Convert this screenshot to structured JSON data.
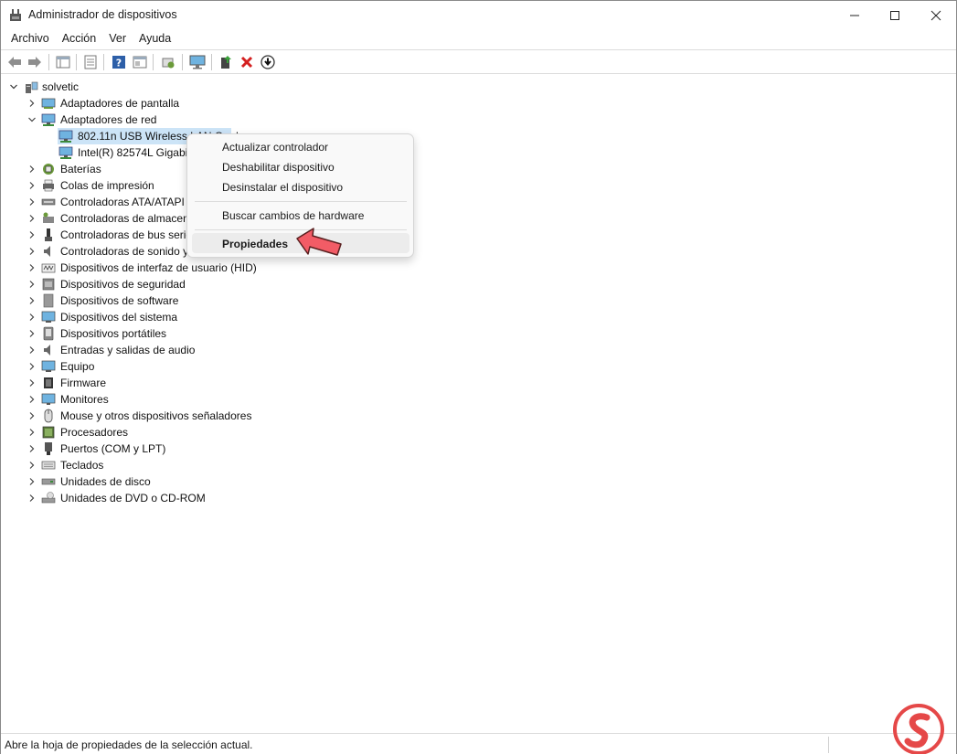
{
  "window": {
    "title": "Administrador de dispositivos"
  },
  "menu": [
    "Archivo",
    "Acción",
    "Ver",
    "Ayuda"
  ],
  "toolbar_icons": [
    "back-arrow-icon",
    "forward-arrow-icon",
    "show-hide-tree-icon",
    "properties-sheet-icon",
    "help-icon",
    "view-pane-icon",
    "scan-hardware-icon",
    "monitor-icon",
    "update-driver-icon",
    "uninstall-x-icon",
    "download-circle-icon"
  ],
  "tree": {
    "root": "solvetic",
    "nodes": [
      {
        "label": "Adaptadores de pantalla",
        "icon": "display-adapter-icon",
        "expanded": false
      },
      {
        "label": "Adaptadores de red",
        "icon": "network-adapter-icon",
        "expanded": true
      },
      {
        "label": "802.11n USB Wireless LAN Card",
        "icon": "network-adapter-icon",
        "child": true,
        "selected": true
      },
      {
        "label": "Intel(R) 82574L Gigabit Network Connection",
        "icon": "network-adapter-icon",
        "child": true
      },
      {
        "label": "Baterías",
        "icon": "battery-icon"
      },
      {
        "label": "Colas de impresión",
        "icon": "printer-icon"
      },
      {
        "label": "Controladoras ATA/ATAPI IDE",
        "icon": "ide-controller-icon"
      },
      {
        "label": "Controladoras de almacenamiento",
        "icon": "storage-controller-icon"
      },
      {
        "label": "Controladoras de bus serie universal",
        "icon": "usb-icon"
      },
      {
        "label": "Controladoras de sonido y vídeo y dispositivos de juego",
        "icon": "speaker-icon"
      },
      {
        "label": "Dispositivos de interfaz de usuario (HID)",
        "icon": "hid-icon"
      },
      {
        "label": "Dispositivos de seguridad",
        "icon": "security-device-icon"
      },
      {
        "label": "Dispositivos de software",
        "icon": "software-device-icon"
      },
      {
        "label": "Dispositivos del sistema",
        "icon": "system-device-icon"
      },
      {
        "label": "Dispositivos portátiles",
        "icon": "portable-device-icon"
      },
      {
        "label": "Entradas y salidas de audio",
        "icon": "audio-io-icon"
      },
      {
        "label": "Equipo",
        "icon": "computer-icon"
      },
      {
        "label": "Firmware",
        "icon": "firmware-icon"
      },
      {
        "label": "Monitores",
        "icon": "monitor-icon"
      },
      {
        "label": "Mouse y otros dispositivos señaladores",
        "icon": "mouse-icon"
      },
      {
        "label": "Procesadores",
        "icon": "processor-icon"
      },
      {
        "label": "Puertos (COM y LPT)",
        "icon": "port-icon"
      },
      {
        "label": "Teclados",
        "icon": "keyboard-icon"
      },
      {
        "label": "Unidades de disco",
        "icon": "disk-drive-icon"
      },
      {
        "label": "Unidades de DVD o CD-ROM",
        "icon": "dvd-drive-icon"
      }
    ]
  },
  "context_menu": {
    "items": [
      "Actualizar controlador",
      "Deshabilitar dispositivo",
      "Desinstalar el dispositivo",
      "Buscar cambios de hardware",
      "Propiedades"
    ],
    "highlighted": "Propiedades"
  },
  "status": {
    "text": "Abre la hoja de propiedades de la selección actual."
  },
  "colors": {
    "selection": "#cce4f7",
    "pointer_arrow": "#f25c66",
    "watermark": "#e54848"
  }
}
